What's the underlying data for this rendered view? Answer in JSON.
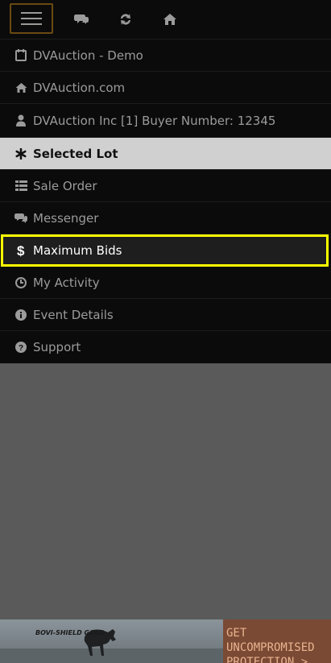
{
  "topbar": {
    "icons": [
      "menu-icon",
      "chat-icon",
      "refresh-icon",
      "home-icon"
    ]
  },
  "menu": {
    "items": [
      {
        "label": "DVAuction - Demo",
        "icon": "calendar-icon"
      },
      {
        "label": "DVAuction.com",
        "icon": "home-icon"
      },
      {
        "label": "DVAuction Inc [1] Buyer Number: 12345",
        "icon": "user-icon"
      },
      {
        "label": "Selected Lot",
        "icon": "asterisk-icon",
        "state": "selected"
      },
      {
        "label": "Sale Order",
        "icon": "list-icon"
      },
      {
        "label": "Messenger",
        "icon": "chat-icon"
      },
      {
        "label": "Maximum Bids",
        "icon": "dollar-icon",
        "state": "highlighted"
      },
      {
        "label": "My Activity",
        "icon": "clock-icon"
      },
      {
        "label": "Event Details",
        "icon": "info-icon"
      },
      {
        "label": "Support",
        "icon": "help-icon"
      }
    ]
  },
  "ad": {
    "brand": "BOVI-SHIELD GOLD",
    "cta_line1": "GET UNCOMPROMISED",
    "cta_line2": "PROTECTION >"
  },
  "colors": {
    "highlight": "#ffff00",
    "selected_bg": "#d0d0d0",
    "menu_bg": "#0b0b0b",
    "overlay_bg": "#5a5a5a"
  }
}
